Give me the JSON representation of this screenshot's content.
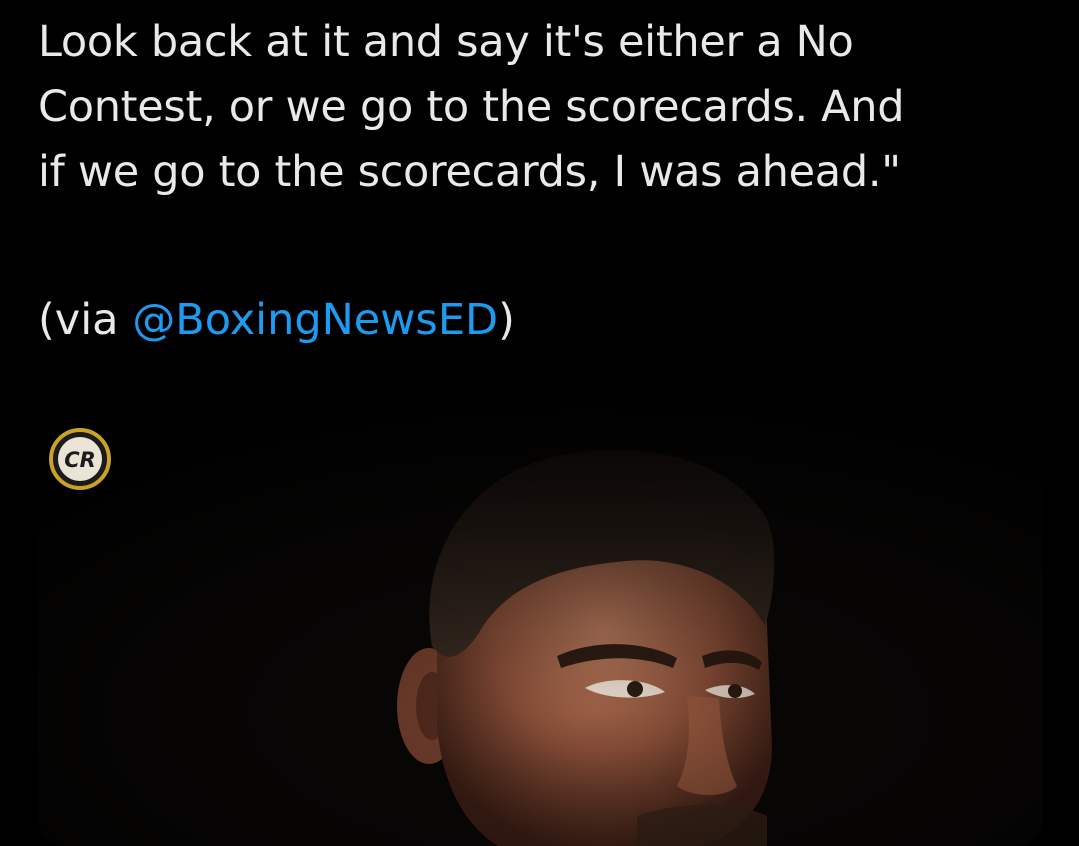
{
  "tweet": {
    "text_lines": [
      "Look back at it and say it's either a No",
      "Contest, or we go to the scorecards. And",
      "if we go to the scorecards, I was ahead.\""
    ],
    "attribution_prefix": "(via ",
    "mention": "@BoxingNewsED",
    "attribution_suffix": ")"
  },
  "media": {
    "logo_text": "CR",
    "logo_colors": {
      "ring": "#c9a227",
      "inner": "#ffffff"
    },
    "background_color": "#060606"
  },
  "colors": {
    "background": "#000000",
    "text": "#e7e9ea",
    "link": "#1d9bf0"
  }
}
